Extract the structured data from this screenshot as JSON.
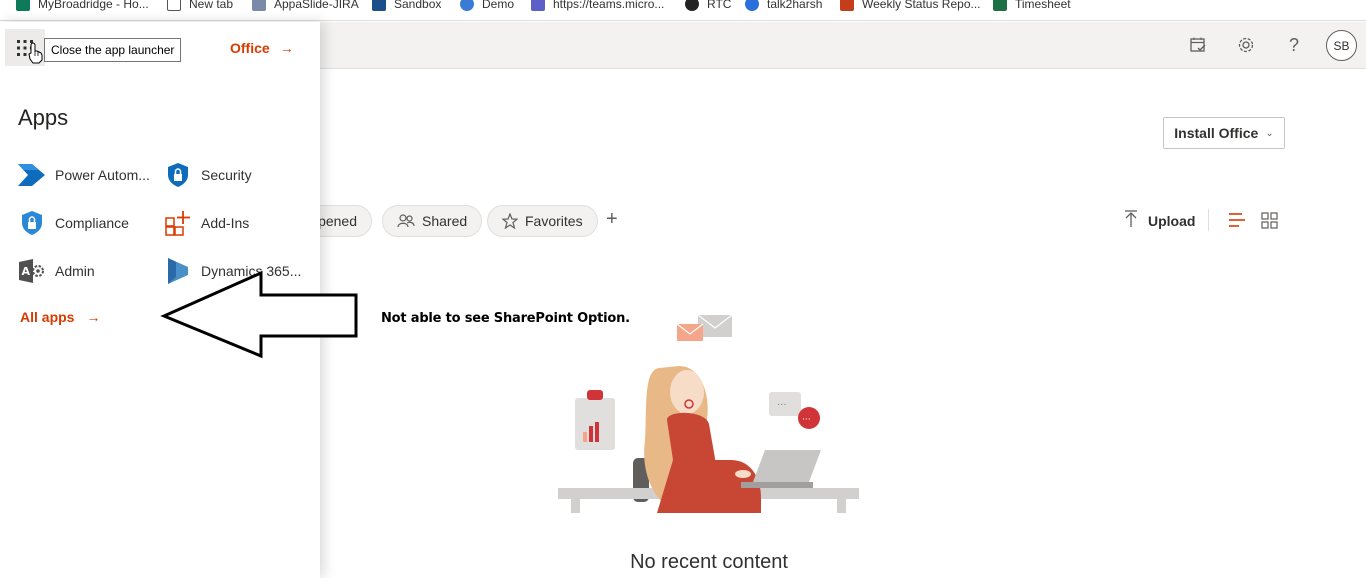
{
  "bookmarks": [
    {
      "label": "MyBroadridge - Ho...",
      "color": "#0e7a5a"
    },
    {
      "label": "New tab",
      "color": "#555555"
    },
    {
      "label": "AppaSlide-JIRA",
      "color": "#7b8aa8"
    },
    {
      "label": "Sandbox",
      "color": "#1a4f8c"
    },
    {
      "label": "Demo",
      "color": "#3a7bd5"
    },
    {
      "label": "https://teams.micro...",
      "color": "#5b5fc7"
    },
    {
      "label": "RTC",
      "color": "#222222"
    },
    {
      "label": "talk2harsh",
      "color": "#2a6fdb"
    },
    {
      "label": "Weekly Status Repo...",
      "color": "#c43e1c"
    },
    {
      "label": "Timesheet",
      "color": "#1d7044"
    }
  ],
  "header": {
    "avatar_initials": "SB",
    "icons": [
      "calendar-check-icon",
      "settings-icon",
      "help-icon"
    ]
  },
  "launcher": {
    "office_label": "Office",
    "tooltip": "Close the app launcher",
    "apps_title": "Apps",
    "apps": [
      {
        "label": "Power Autom...",
        "icon": "power-automate-icon"
      },
      {
        "label": "Security",
        "icon": "security-shield-icon"
      },
      {
        "label": "Compliance",
        "icon": "compliance-shield-icon"
      },
      {
        "label": "Add-Ins",
        "icon": "add-ins-icon"
      },
      {
        "label": "Admin",
        "icon": "admin-icon"
      },
      {
        "label": "Dynamics 365...",
        "icon": "dynamics-365-icon"
      }
    ],
    "all_apps_label": "All apps"
  },
  "main": {
    "install_label": "Install Office",
    "filters": [
      {
        "label": "Recently opened",
        "visible_text": "pened"
      },
      {
        "label": "Shared"
      },
      {
        "label": "Favorites"
      }
    ],
    "upload_label": "Upload",
    "annotation": "Not able to see SharePoint Option.",
    "empty_state": "No recent content"
  },
  "colors": {
    "accent": "#d83b01",
    "header_bg": "#f3f2f1"
  }
}
